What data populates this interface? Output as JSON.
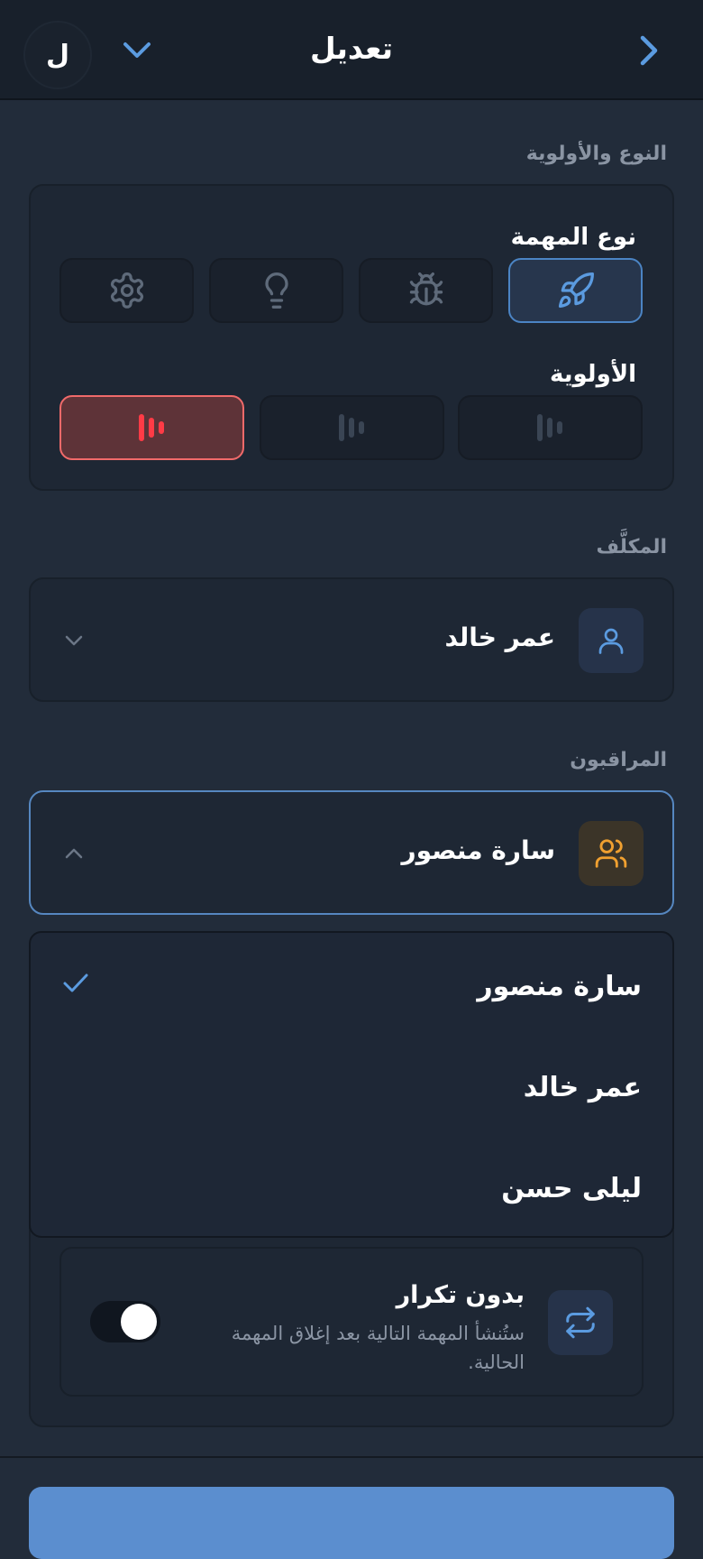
{
  "header": {
    "title": "تعديل",
    "avatar_letter": "ل",
    "back_icon": "chevron-right-icon",
    "menu_icon": "chevron-down-icon"
  },
  "type_priority": {
    "section_label": "النوع والأولوية",
    "task_type_label": "نوع المهمة",
    "task_types": [
      {
        "icon": "rocket-icon",
        "selected": true
      },
      {
        "icon": "bug-icon",
        "selected": false
      },
      {
        "icon": "lightbulb-icon",
        "selected": false
      },
      {
        "icon": "gear-icon",
        "selected": false
      }
    ],
    "priority_label": "الأولوية",
    "priorities": [
      {
        "icon": "priority-bars-icon",
        "selected": false
      },
      {
        "icon": "priority-bars-icon",
        "selected": false
      },
      {
        "icon": "priority-bars-icon",
        "selected": true
      }
    ]
  },
  "assignee": {
    "section_label": "المكلَّف",
    "value": "عمر خالد",
    "icon": "user-icon"
  },
  "watchers": {
    "section_label": "المراقبون",
    "value": "سارة منصور",
    "icon": "users-icon",
    "options": [
      {
        "label": "سارة منصور",
        "checked": true
      },
      {
        "label": "عمر خالد",
        "checked": false
      },
      {
        "label": "ليلى حسن",
        "checked": false
      }
    ]
  },
  "recurrence": {
    "title": "بدون تكرار",
    "description": "ستُنشأ المهمة التالية بعد إغلاق المهمة الحالية.",
    "icon": "repeat-icon",
    "toggle_on": true
  },
  "colors": {
    "accent": "#5b8ecf",
    "danger": "#f06a6a",
    "orange": "#f0a030"
  }
}
